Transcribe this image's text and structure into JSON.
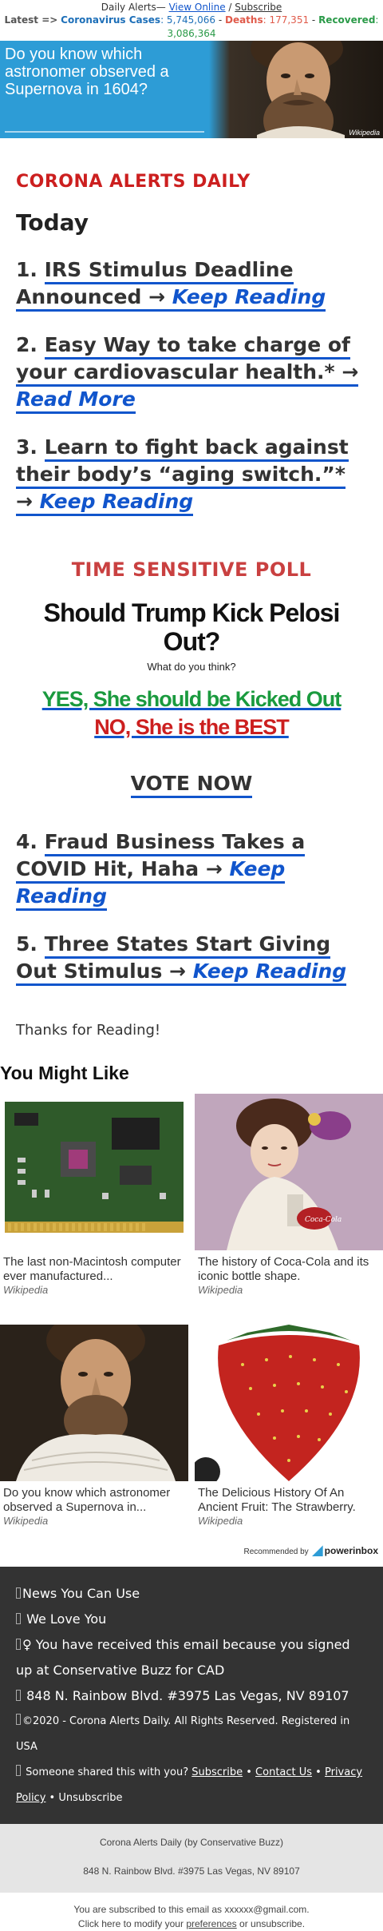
{
  "header": {
    "alerts_prefix": "Daily Alerts— ",
    "view_online": "View Online",
    "separator": " / ",
    "subscribe": "Subscribe",
    "latest_label": "Latest =>",
    "cases_label": "Coronavirus Cases",
    "cases_value": ": 5,745,066",
    "dash1": " - ",
    "deaths_label": "Deaths",
    "deaths_value": ": 177,351",
    "dash2": " - ",
    "recovered_label": "Recovered",
    "recovered_value": ": 3,086,364",
    "colors": {
      "cases": "#1d6fb8",
      "deaths": "#e05a4a",
      "recovered": "#2a9a48"
    }
  },
  "banner": {
    "text": "Do you know which astronomer observed a Supernova in 1604?",
    "source": "Wikipedia"
  },
  "brand": "CORONA ALERTS DAILY",
  "today": "Today",
  "stories": [
    {
      "num": "1. ",
      "title": "IRS Stimulus Deadline Announced",
      "arrow": " → ",
      "link": "Keep Reading"
    },
    {
      "num": " 2. ",
      "title": "Easy Way to take charge of your cardiovascular health.*",
      "arrow": " → ",
      "link": "Read More"
    },
    {
      "num": " 3. ",
      "title": "Learn to fight back against their body’s “aging switch.”*",
      "arrow": " → ",
      "link": "Keep Reading"
    },
    {
      "num": " 4. ",
      "title": "Fraud Business Takes a COVID Hit, Haha",
      "arrow": " → ",
      "link": "Keep Reading"
    },
    {
      "num": " 5. ",
      "title": "Three States Start Giving Out Stimulus",
      "arrow": " → ",
      "link": "Keep Reading"
    }
  ],
  "poll": {
    "title": "TIME SENSITIVE POLL",
    "question": "Should Trump Kick Pelosi Out?",
    "prompt": "What do you think?",
    "yes": "YES, She should be Kicked Out",
    "no": "NO, She is the BEST",
    "vote": "VOTE NOW"
  },
  "thanks": "Thanks for Reading!",
  "you_might_like": {
    "title": "You Might Like",
    "cards": [
      {
        "image": "circuit-board",
        "title": "The last non-Macintosh computer ever manufactured...",
        "source": "Wikipedia"
      },
      {
        "image": "coca-cola-poster",
        "title": "The history of Coca-Cola and its iconic bottle shape.",
        "source": "Wikipedia"
      },
      {
        "image": "astronomer-portrait",
        "title": "Do you know which astronomer observed a Supernova in...",
        "source": "Wikipedia"
      },
      {
        "image": "strawberry",
        "title": "The Delicious History Of An Ancient Fruit: The Strawberry.",
        "source": "Wikipedia"
      }
    ],
    "recommended_by": "Recommended by",
    "provider": "powerinbox"
  },
  "footer": {
    "line1": "News You Can Use",
    "line2": " We Love You",
    "line3": "♀ You have received this email because you signed up at Conservative Buzz for CAD",
    "line4": " 848 N. Rainbow Blvd. #3975 Las Vegas, NV 89107",
    "line5": "©2020 - Corona Alerts Daily. All Rights Reserved. Registered in USA",
    "line6_prefix": " Someone shared this with you? ",
    "subscribe": "Subscribe",
    "bullet1": " • ",
    "contact": "Contact Us",
    "bullet2": " • ",
    "privacy": "Privacy Policy",
    "bullet3": " • ",
    "unsubscribe": "Unsubscribe"
  },
  "company": {
    "name": "Corona Alerts Daily (by Conservative Buzz)",
    "address": "848 N. Rainbow Blvd. #3975 Las Vegas, NV 89107"
  },
  "subscription": {
    "line1": "You are subscribed to this email as xxxxxx@gmail.com.",
    "line2_prefix": "Click here to modify your ",
    "preferences": "preferences",
    "line2_suffix": " or unsubscribe."
  }
}
